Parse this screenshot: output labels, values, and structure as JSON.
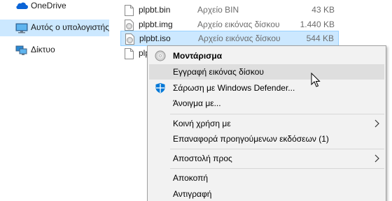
{
  "nav": {
    "items": [
      {
        "label": "OneDrive",
        "icon": "onedrive-cloud-icon",
        "selected": false
      },
      {
        "label": "Αυτός ο υπολογιστής",
        "icon": "computer-icon",
        "selected": true
      },
      {
        "label": "Δίκτυο",
        "icon": "network-icon",
        "selected": false
      }
    ]
  },
  "files": [
    {
      "name": "plpbt.bin",
      "type": "Αρχείο BIN",
      "size": "43 KB",
      "selected": false
    },
    {
      "name": "plpbt.img",
      "type": "Αρχείο εικόνας δίσκου",
      "size": "1.440 KB",
      "selected": false
    },
    {
      "name": "plpbt.iso",
      "type": "Αρχείο εικόνας δίσκου",
      "size": "544 KB",
      "selected": true
    },
    {
      "name": "plp",
      "type": "",
      "size": "",
      "selected": false
    }
  ],
  "context_menu": {
    "items": [
      {
        "label": "Μοντάρισμα",
        "bold": true,
        "icon": "disc-mount-icon"
      },
      {
        "label": "Εγγραφή εικόνας δίσκου",
        "hovered": true
      },
      {
        "label": "Σάρωση με Windows Defender...",
        "icon": "windows-defender-icon"
      },
      {
        "label": "Άνοιγμα με..."
      },
      {
        "label": "Κοινή χρήση με",
        "submenu": true
      },
      {
        "label": "Επαναφορά προηγούμενων εκδόσεων (1)"
      },
      {
        "label": "Αποστολή προς",
        "submenu": true
      },
      {
        "label": "Αποκοπή"
      },
      {
        "label": "Αντιγραφή"
      }
    ]
  },
  "colors": {
    "selection": "#cce8ff",
    "menu_background": "#f2f2f2",
    "menu_hover": "#dedede",
    "onedrive_blue": "#0a64d6",
    "defender_blue": "#0078d7"
  }
}
